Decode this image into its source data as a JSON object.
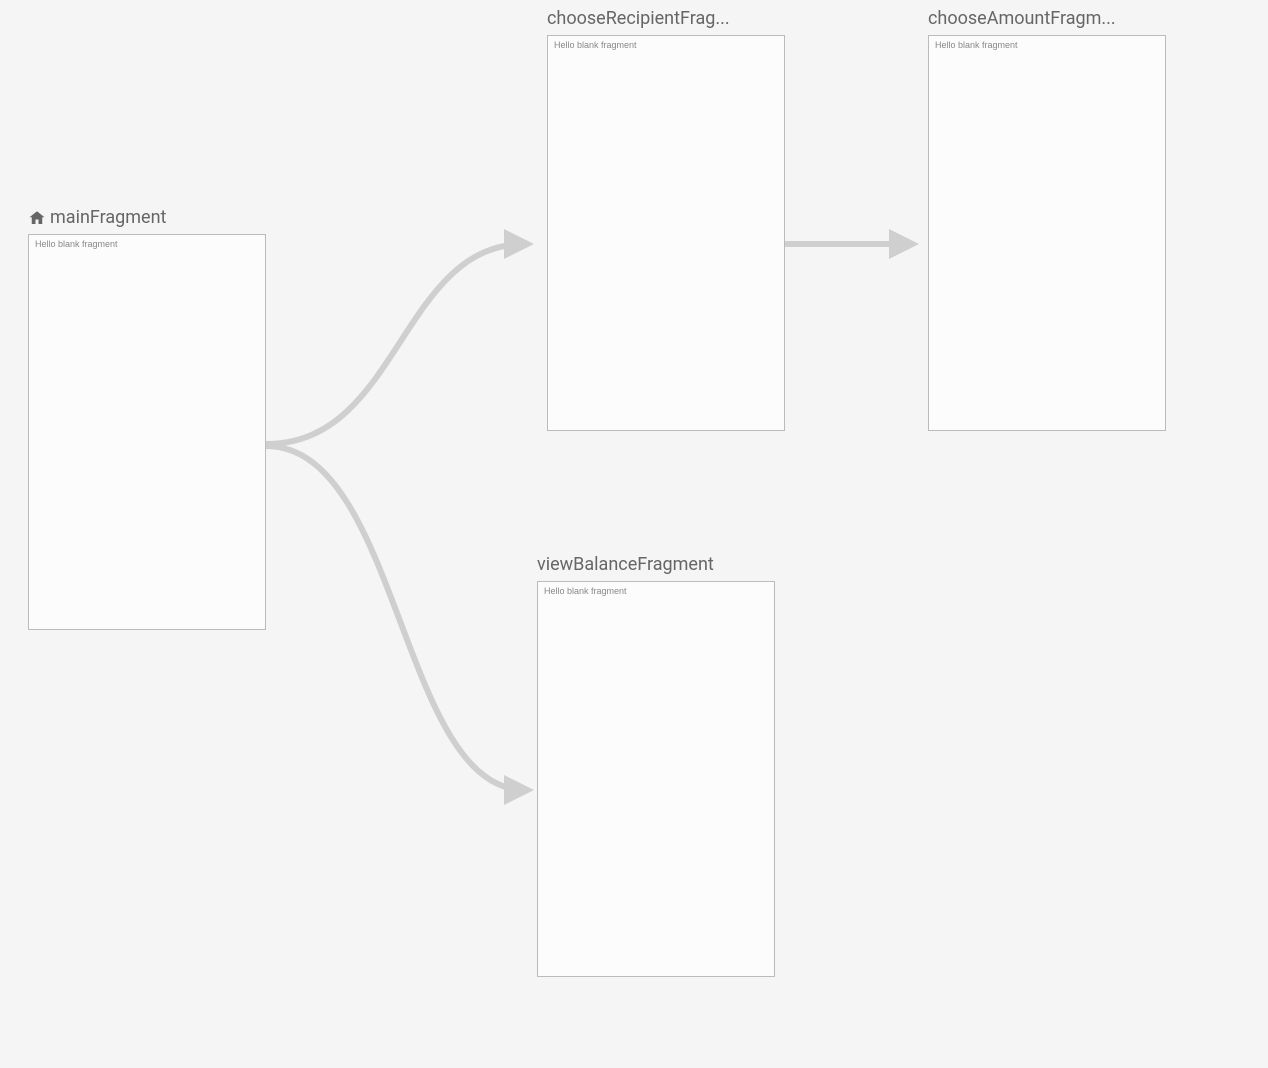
{
  "nodes": {
    "main": {
      "title": "mainFragment",
      "content": "Hello blank fragment",
      "isStart": true
    },
    "recipient": {
      "title": "chooseRecipientFrag...",
      "content": "Hello blank fragment",
      "isStart": false
    },
    "amount": {
      "title": "chooseAmountFragm...",
      "content": "Hello blank fragment",
      "isStart": false
    },
    "balance": {
      "title": "viewBalanceFragment",
      "content": "Hello blank fragment",
      "isStart": false
    }
  }
}
